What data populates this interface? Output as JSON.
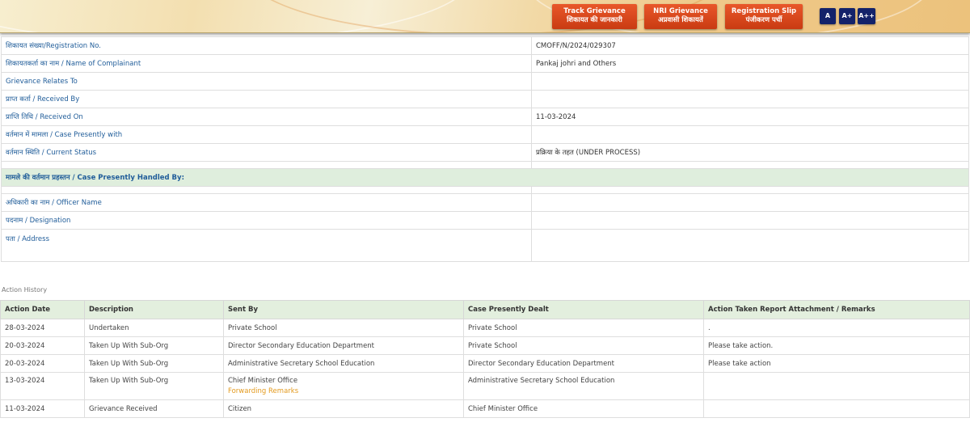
{
  "header": {
    "buttons": [
      {
        "line1": "Track Grievance",
        "line2": "शिकायत की जानकारी"
      },
      {
        "line1": "NRI Grievance",
        "line2": "अप्रवासी शिकायतें"
      },
      {
        "line1": "Registration Slip",
        "line2": "पंजीकरण पर्ची"
      }
    ],
    "font_sizes": [
      "A",
      "A+",
      "A++"
    ]
  },
  "details": {
    "registration_no": {
      "label": "शिकायत संख्या/Registration No.",
      "value": "CMOFF/N/2024/029307"
    },
    "complainant": {
      "label": "शिकायतकर्ता का नाम / Name of Complainant",
      "value": "Pankaj johri and Others"
    },
    "relates_to": {
      "label": "Grievance Relates To",
      "value": ""
    },
    "received_by": {
      "label": "प्राप्त कर्ता / Received By",
      "value": ""
    },
    "received_on": {
      "label": "प्राप्ति तिथि / Received On",
      "value": "11-03-2024"
    },
    "presently_with": {
      "label": "वर्तमान में मामला / Case Presently with",
      "value": ""
    },
    "current_status": {
      "label": "वर्तमान स्थिति / Current Status",
      "value": "प्रक्रिया के तहत (UNDER PROCESS)"
    }
  },
  "handled": {
    "heading": "मामले की वर्तमान प्रहस्तन / Case Presently Handled By:",
    "officer_name": {
      "label": "अधिकारी का नाम / Officer Name",
      "value": ""
    },
    "designation": {
      "label": "पदनाम / Designation",
      "value": ""
    },
    "address": {
      "label": "पता / Address",
      "value": ""
    }
  },
  "history": {
    "title": "Action History",
    "columns": [
      "Action Date",
      "Description",
      "Sent By",
      "Case Presently Dealt",
      "Action Taken Report Attachment / Remarks"
    ],
    "rows": [
      {
        "date": "28-03-2024",
        "description": "Undertaken",
        "sent_by": "Private School",
        "dealt": "Private School",
        "remarks": "."
      },
      {
        "date": "20-03-2024",
        "description": "Taken Up With Sub-Org",
        "sent_by": "Director Secondary Education Department",
        "dealt": "Private School",
        "remarks": "Please take action."
      },
      {
        "date": "20-03-2024",
        "description": "Taken Up With Sub-Org",
        "sent_by": "Administrative Secretary School Education",
        "dealt": "Director Secondary Education Department",
        "remarks": "Please take action"
      },
      {
        "date": "13-03-2024",
        "description": "Taken Up With Sub-Org",
        "sent_by": "Chief Minister Office",
        "link": "Forwarding Remarks",
        "dealt": "Administrative Secretary School Education",
        "remarks": ""
      },
      {
        "date": "11-03-2024",
        "description": "Grievance Received",
        "sent_by": "Citizen",
        "dealt": "Chief Minister Office",
        "remarks": ""
      }
    ]
  },
  "colors": {
    "nav_button": "#d9461b",
    "font_button": "#13226a",
    "label_text": "#1f5c99",
    "section_bg": "#dfeedd",
    "link": "#e39a1e"
  }
}
